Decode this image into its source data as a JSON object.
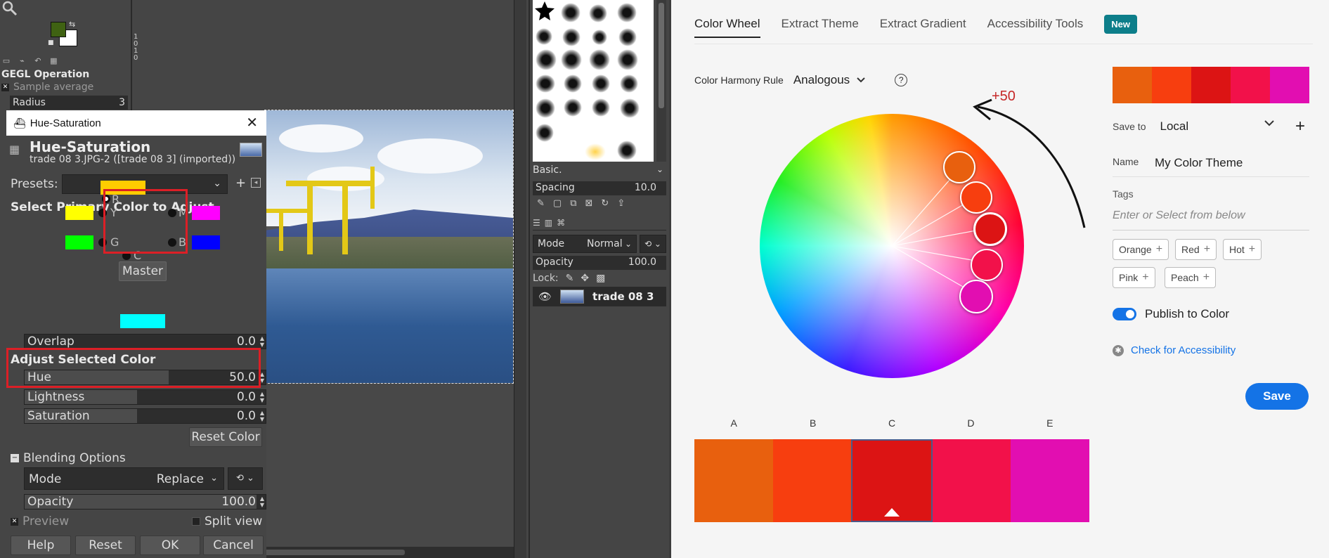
{
  "gimp": {
    "toolbox": {
      "gegl_title": "GEGL Operation",
      "sample_average": "Sample average",
      "radius_label": "Radius",
      "radius_value": "3",
      "ruler_digits": [
        "1",
        "0",
        "1",
        "0"
      ]
    },
    "dialog": {
      "window_title": "Hue-Saturation",
      "heading": "Hue-Saturation",
      "subheading": "trade 08 3.JPG-2 ([trade 08 3] (imported))",
      "presets_label": "Presets:",
      "select_primary": "Select Primary Color to Adjust",
      "channels": {
        "R": "R",
        "Y": "Y",
        "M": "M",
        "G": "G",
        "B": "B",
        "C": "C"
      },
      "master_label": "Master",
      "overlap_label": "Overlap",
      "overlap_value": "0.0",
      "adjust_selected": "Adjust Selected Color",
      "hue_label": "Hue",
      "hue_value": "50.0",
      "lightness_label": "Lightness",
      "lightness_value": "0.0",
      "saturation_label": "Saturation",
      "saturation_value": "0.0",
      "reset_color": "Reset Color",
      "blending_options": "Blending Options",
      "mode_label": "Mode",
      "mode_value": "Replace",
      "opacity_label": "Opacity",
      "opacity_value": "100.0",
      "preview_label": "Preview",
      "split_view_label": "Split view",
      "buttons": {
        "help": "Help",
        "reset": "Reset",
        "ok": "OK",
        "cancel": "Cancel"
      }
    },
    "brushes": {
      "preset_name": "Basic.",
      "spacing_label": "Spacing",
      "spacing_value": "10.0"
    },
    "layers": {
      "mode_label": "Mode",
      "mode_value": "Normal",
      "opacity_label": "Opacity",
      "opacity_value": "100.0",
      "lock_label": "Lock:",
      "layer_name": "trade 08 3"
    },
    "colors": {
      "fg": "#3f6212",
      "bg": "#ffffff",
      "red_swatch": "#ffcc00",
      "yellow": "#ffff00",
      "magenta": "#ff00ff",
      "green": "#00ff00",
      "blue": "#0000ff",
      "cyan": "#00ffff",
      "highlight": "#dc1f26"
    }
  },
  "adobe_color": {
    "tabs": [
      "Color Wheel",
      "Extract Theme",
      "Extract Gradient",
      "Accessibility Tools"
    ],
    "new_badge": "New",
    "harmony_label": "Color Harmony Rule",
    "harmony_value": "Analogous",
    "rotation_annotation": "+50",
    "save_to_label": "Save to",
    "save_to_value": "Local",
    "name_label": "Name",
    "name_value": "My Color Theme",
    "tags_label": "Tags",
    "tags_placeholder": "Enter or Select from below",
    "tags": [
      "Orange",
      "Red",
      "Hot",
      "Pink",
      "Peach"
    ],
    "publish_label": "Publish to Color",
    "accessibility_link": "Check for Accessibility",
    "save_button": "Save",
    "swatch_letters": [
      "A",
      "B",
      "C",
      "D",
      "E"
    ],
    "theme_colors": [
      "#e8600e",
      "#f73e0f",
      "#dc1414",
      "#f2114a",
      "#e20eb1"
    ],
    "selected_swatch_index": 2
  }
}
